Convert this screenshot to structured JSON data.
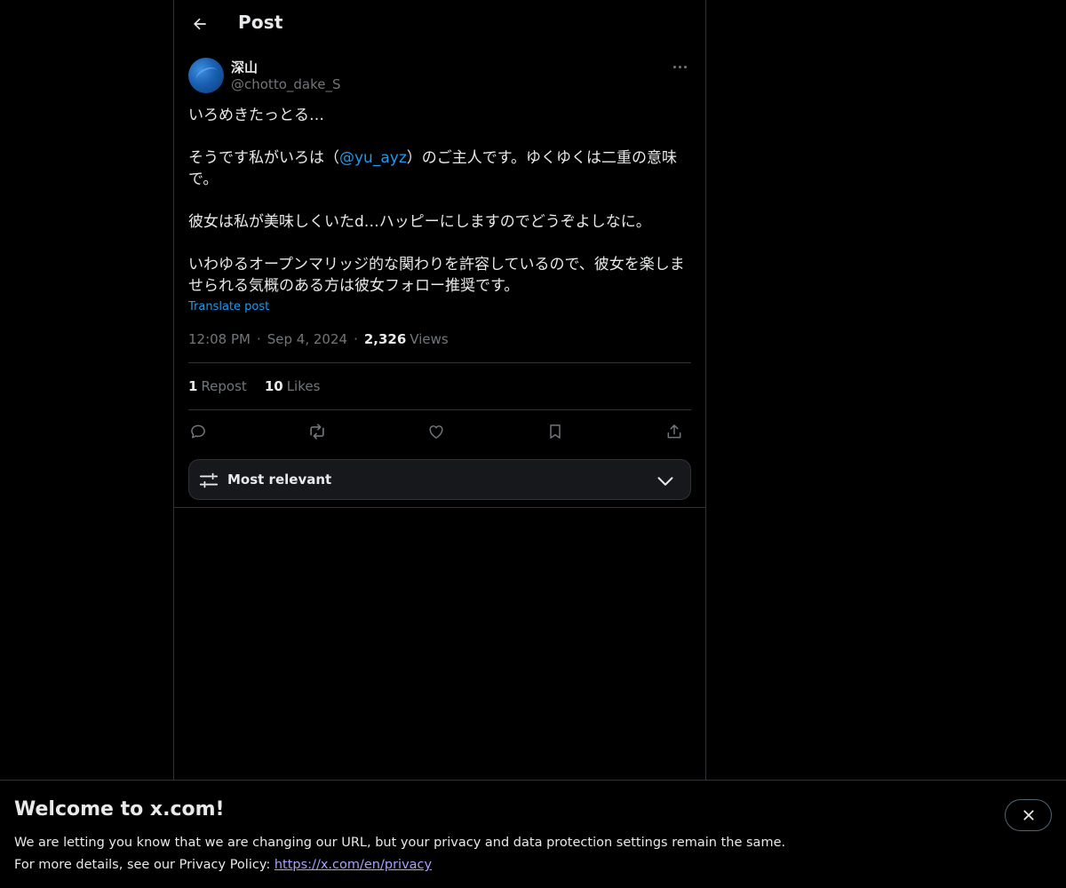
{
  "header": {
    "title": "Post",
    "back_icon": "arrow-left-icon"
  },
  "post": {
    "author": {
      "display_name": "深山",
      "handle": "@chotto_dake_S"
    },
    "text_line1": "いろめきたっとる…",
    "text_p2_before": "そうです私がいろは（",
    "text_p2_mention": "@yu_ayz",
    "text_p2_after": "）のご主人です。ゆくゆくは二重の意味\nで。",
    "text_p3": "彼女は私が美味しくいたd…ハッピーにしますのでどうぞよしなに。",
    "text_p4": "いわゆるオープンマリッジ的な関わりを許容しているので、彼女を楽しま\nせられる気概のある方は彼女フォロー推奨です。",
    "translate_label": "Translate post",
    "time": "12:08 PM",
    "date": "Sep 4, 2024",
    "separator": "·",
    "views_count": "2,326",
    "views_label": "Views",
    "reposts_count": "1",
    "reposts_label": "Repost",
    "likes_count": "10",
    "likes_label": "Likes"
  },
  "actions": [
    {
      "icon": "reply-icon"
    },
    {
      "icon": "repost-icon"
    },
    {
      "icon": "like-icon"
    },
    {
      "icon": "bookmark-icon"
    },
    {
      "icon": "share-icon"
    }
  ],
  "replies_sort": {
    "label": "Most relevant",
    "icon": "sliders-icon",
    "chevron": "chevron-down-icon"
  },
  "banner": {
    "title": "Welcome to x.com!",
    "line1": "We are letting you know that we are changing our URL, but your privacy and data protection settings remain the same.",
    "line2_prefix": "For more details, see our Privacy Policy: ",
    "link": "https://x.com/en/privacy"
  },
  "colors": {
    "background": "#000000",
    "text": "#e7e9ea",
    "muted": "#71767b",
    "accent": "#1d9bf0",
    "border": "#2f3336",
    "banner_link": "#a8a1ff"
  }
}
